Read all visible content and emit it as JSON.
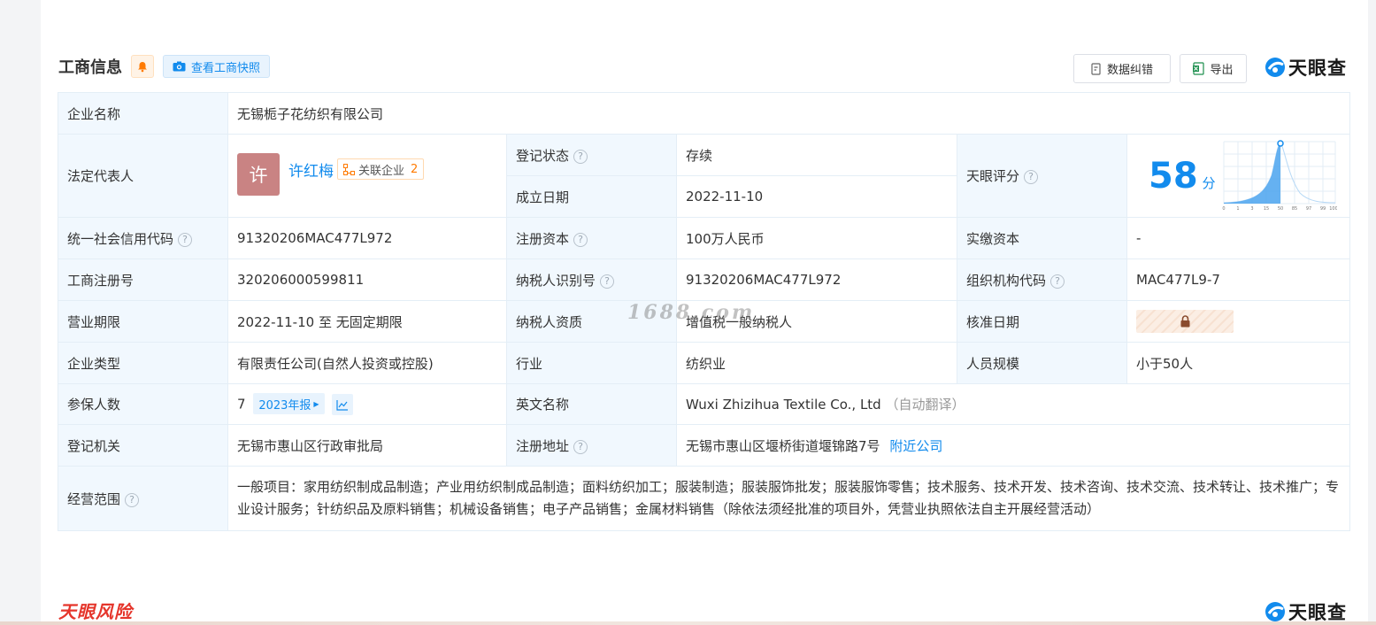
{
  "header": {
    "title": "工商信息",
    "snapshot_label": "查看工商快照",
    "correct_label": "数据纠错",
    "export_label": "导出",
    "brand": "天眼查"
  },
  "rows": {
    "company_name": {
      "label": "企业名称",
      "value": "无锡栀子花纺织有限公司"
    },
    "legal_rep": {
      "label": "法定代表人",
      "avatar_char": "许",
      "name": "许红梅",
      "related_label": "关联企业",
      "related_count": "2"
    },
    "reg_status": {
      "label": "登记状态",
      "value": "存续"
    },
    "established": {
      "label": "成立日期",
      "value": "2022-11-10"
    },
    "score": {
      "label": "天眼评分",
      "value": "58",
      "unit": "分",
      "axis_ticks": [
        "0",
        "1",
        "3",
        "15",
        "50",
        "85",
        "97",
        "99",
        "100"
      ]
    },
    "credit_code": {
      "label": "统一社会信用代码",
      "value": "91320206MAC477L972"
    },
    "reg_capital": {
      "label": "注册资本",
      "value": "100万人民币"
    },
    "paid_capital": {
      "label": "实缴资本",
      "value": "-"
    },
    "reg_no": {
      "label": "工商注册号",
      "value": "320206000599811"
    },
    "taxpayer_id": {
      "label": "纳税人识别号",
      "value": "91320206MAC477L972"
    },
    "org_code": {
      "label": "组织机构代码",
      "value": "MAC477L9-7"
    },
    "term": {
      "label": "营业期限",
      "value": "2022-11-10 至 无固定期限"
    },
    "taxpayer_qual": {
      "label": "纳税人资质",
      "value": "增值税一般纳税人"
    },
    "approval_date": {
      "label": "核准日期"
    },
    "company_type": {
      "label": "企业类型",
      "value": "有限责任公司(自然人投资或控股)"
    },
    "industry": {
      "label": "行业",
      "value": "纺织业"
    },
    "staff_size": {
      "label": "人员规模",
      "value": "小于50人"
    },
    "insured": {
      "label": "参保人数",
      "value": "7",
      "report_tag": "2023年报"
    },
    "english_name": {
      "label": "英文名称",
      "value": "Wuxi Zhizihua Textile Co., Ltd",
      "note": "（自动翻译）"
    },
    "authority": {
      "label": "登记机关",
      "value": "无锡市惠山区行政审批局"
    },
    "address": {
      "label": "注册地址",
      "value": "无锡市惠山区堰桥街道堰锦路7号",
      "nearby": "附近公司"
    },
    "scope": {
      "label": "经营范围",
      "value": "一般项目：家用纺织制成品制造；产业用纺织制成品制造；面料纺织加工；服装制造；服装服饰批发；服装服饰零售；技术服务、技术开发、技术咨询、技术交流、技术转让、技术推广；专业设计服务；针纺织品及原料销售；机械设备销售；电子产品销售；金属材料销售（除依法须经批准的项目外，凭营业执照依法自主开展经营活动）"
    }
  },
  "watermark": "1688.com",
  "footer": {
    "section_title": "天眼风险",
    "brand": "天眼查"
  }
}
